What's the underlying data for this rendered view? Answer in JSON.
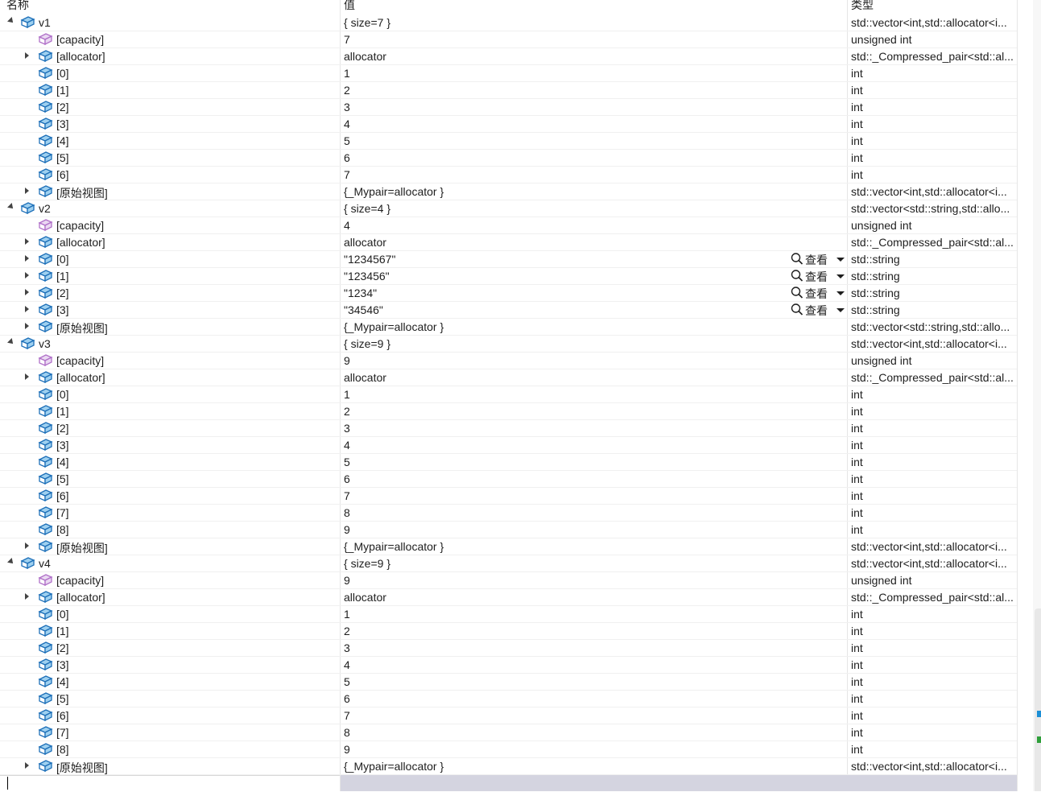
{
  "header": {
    "name": "名称",
    "value": "值",
    "type": "类型"
  },
  "viewer_label": "查看",
  "colors": {
    "cube_fill": "#9ed0f0",
    "cube_stroke": "#1d6fb8",
    "capacity_stroke": "#b070c8"
  },
  "rows": [
    {
      "level": 0,
      "expand": "open",
      "icon": "variable-icon",
      "name": "v1",
      "value": "{ size=7 }",
      "type": "std::vector<int,std::allocator<i..."
    },
    {
      "level": 1,
      "expand": "none",
      "icon": "property-icon",
      "name": "[capacity]",
      "value": "7",
      "type": "unsigned int"
    },
    {
      "level": 1,
      "expand": "closed",
      "icon": "variable-icon",
      "name": "[allocator]",
      "value": "allocator",
      "type": "std::_Compressed_pair<std::al..."
    },
    {
      "level": 1,
      "expand": "none",
      "icon": "variable-icon",
      "name": "[0]",
      "value": "1",
      "type": "int"
    },
    {
      "level": 1,
      "expand": "none",
      "icon": "variable-icon",
      "name": "[1]",
      "value": "2",
      "type": "int"
    },
    {
      "level": 1,
      "expand": "none",
      "icon": "variable-icon",
      "name": "[2]",
      "value": "3",
      "type": "int"
    },
    {
      "level": 1,
      "expand": "none",
      "icon": "variable-icon",
      "name": "[3]",
      "value": "4",
      "type": "int"
    },
    {
      "level": 1,
      "expand": "none",
      "icon": "variable-icon",
      "name": "[4]",
      "value": "5",
      "type": "int"
    },
    {
      "level": 1,
      "expand": "none",
      "icon": "variable-icon",
      "name": "[5]",
      "value": "6",
      "type": "int"
    },
    {
      "level": 1,
      "expand": "none",
      "icon": "variable-icon",
      "name": "[6]",
      "value": "7",
      "type": "int"
    },
    {
      "level": 1,
      "expand": "closed",
      "icon": "variable-icon",
      "name": "[原始视图]",
      "value": "{_Mypair=allocator }",
      "type": "std::vector<int,std::allocator<i..."
    },
    {
      "level": 0,
      "expand": "open",
      "icon": "variable-icon",
      "name": "v2",
      "value": "{ size=4 }",
      "type": "std::vector<std::string,std::allo..."
    },
    {
      "level": 1,
      "expand": "none",
      "icon": "property-icon",
      "name": "[capacity]",
      "value": "4",
      "type": "unsigned int"
    },
    {
      "level": 1,
      "expand": "closed",
      "icon": "variable-icon",
      "name": "[allocator]",
      "value": "allocator",
      "type": "std::_Compressed_pair<std::al..."
    },
    {
      "level": 1,
      "expand": "closed",
      "icon": "variable-icon",
      "name": "[0]",
      "value": "\"1234567\"",
      "type": "std::string",
      "viewer": true
    },
    {
      "level": 1,
      "expand": "closed",
      "icon": "variable-icon",
      "name": "[1]",
      "value": "\"123456\"",
      "type": "std::string",
      "viewer": true
    },
    {
      "level": 1,
      "expand": "closed",
      "icon": "variable-icon",
      "name": "[2]",
      "value": "\"1234\"",
      "type": "std::string",
      "viewer": true
    },
    {
      "level": 1,
      "expand": "closed",
      "icon": "variable-icon",
      "name": "[3]",
      "value": "\"34546\"",
      "type": "std::string",
      "viewer": true
    },
    {
      "level": 1,
      "expand": "closed",
      "icon": "variable-icon",
      "name": "[原始视图]",
      "value": "{_Mypair=allocator }",
      "type": "std::vector<std::string,std::allo..."
    },
    {
      "level": 0,
      "expand": "open",
      "icon": "variable-icon",
      "name": "v3",
      "value": "{ size=9 }",
      "type": "std::vector<int,std::allocator<i..."
    },
    {
      "level": 1,
      "expand": "none",
      "icon": "property-icon",
      "name": "[capacity]",
      "value": "9",
      "type": "unsigned int"
    },
    {
      "level": 1,
      "expand": "closed",
      "icon": "variable-icon",
      "name": "[allocator]",
      "value": "allocator",
      "type": "std::_Compressed_pair<std::al..."
    },
    {
      "level": 1,
      "expand": "none",
      "icon": "variable-icon",
      "name": "[0]",
      "value": "1",
      "type": "int"
    },
    {
      "level": 1,
      "expand": "none",
      "icon": "variable-icon",
      "name": "[1]",
      "value": "2",
      "type": "int"
    },
    {
      "level": 1,
      "expand": "none",
      "icon": "variable-icon",
      "name": "[2]",
      "value": "3",
      "type": "int"
    },
    {
      "level": 1,
      "expand": "none",
      "icon": "variable-icon",
      "name": "[3]",
      "value": "4",
      "type": "int"
    },
    {
      "level": 1,
      "expand": "none",
      "icon": "variable-icon",
      "name": "[4]",
      "value": "5",
      "type": "int"
    },
    {
      "level": 1,
      "expand": "none",
      "icon": "variable-icon",
      "name": "[5]",
      "value": "6",
      "type": "int"
    },
    {
      "level": 1,
      "expand": "none",
      "icon": "variable-icon",
      "name": "[6]",
      "value": "7",
      "type": "int"
    },
    {
      "level": 1,
      "expand": "none",
      "icon": "variable-icon",
      "name": "[7]",
      "value": "8",
      "type": "int"
    },
    {
      "level": 1,
      "expand": "none",
      "icon": "variable-icon",
      "name": "[8]",
      "value": "9",
      "type": "int"
    },
    {
      "level": 1,
      "expand": "closed",
      "icon": "variable-icon",
      "name": "[原始视图]",
      "value": "{_Mypair=allocator }",
      "type": "std::vector<int,std::allocator<i..."
    },
    {
      "level": 0,
      "expand": "open",
      "icon": "variable-icon",
      "name": "v4",
      "value": "{ size=9 }",
      "type": "std::vector<int,std::allocator<i..."
    },
    {
      "level": 1,
      "expand": "none",
      "icon": "property-icon",
      "name": "[capacity]",
      "value": "9",
      "type": "unsigned int"
    },
    {
      "level": 1,
      "expand": "closed",
      "icon": "variable-icon",
      "name": "[allocator]",
      "value": "allocator",
      "type": "std::_Compressed_pair<std::al..."
    },
    {
      "level": 1,
      "expand": "none",
      "icon": "variable-icon",
      "name": "[0]",
      "value": "1",
      "type": "int"
    },
    {
      "level": 1,
      "expand": "none",
      "icon": "variable-icon",
      "name": "[1]",
      "value": "2",
      "type": "int"
    },
    {
      "level": 1,
      "expand": "none",
      "icon": "variable-icon",
      "name": "[2]",
      "value": "3",
      "type": "int"
    },
    {
      "level": 1,
      "expand": "none",
      "icon": "variable-icon",
      "name": "[3]",
      "value": "4",
      "type": "int"
    },
    {
      "level": 1,
      "expand": "none",
      "icon": "variable-icon",
      "name": "[4]",
      "value": "5",
      "type": "int"
    },
    {
      "level": 1,
      "expand": "none",
      "icon": "variable-icon",
      "name": "[5]",
      "value": "6",
      "type": "int"
    },
    {
      "level": 1,
      "expand": "none",
      "icon": "variable-icon",
      "name": "[6]",
      "value": "7",
      "type": "int"
    },
    {
      "level": 1,
      "expand": "none",
      "icon": "variable-icon",
      "name": "[7]",
      "value": "8",
      "type": "int"
    },
    {
      "level": 1,
      "expand": "none",
      "icon": "variable-icon",
      "name": "[8]",
      "value": "9",
      "type": "int"
    },
    {
      "level": 1,
      "expand": "closed",
      "icon": "variable-icon",
      "name": "[原始视图]",
      "value": "{_Mypair=allocator }",
      "type": "std::vector<int,std::allocator<i..."
    }
  ]
}
